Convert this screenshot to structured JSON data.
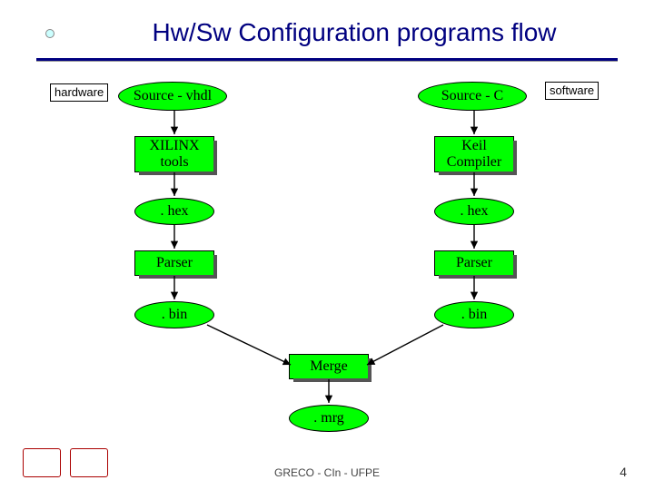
{
  "title": "Hw/Sw Configuration programs flow",
  "labels": {
    "hardware": "hardware",
    "software": "software"
  },
  "hw": {
    "source": "Source - vhdl",
    "tool": "XILINX\ntools",
    "hex": ". hex",
    "parser": "Parser",
    "bin": ". bin"
  },
  "sw": {
    "source": "Source - C",
    "tool": "Keil\nCompiler",
    "hex": ". hex",
    "parser": "Parser",
    "bin": ". bin"
  },
  "merge": "Merge",
  "mrg": ". mrg",
  "footer": "GRECO - CIn - UFPE",
  "page": "4"
}
